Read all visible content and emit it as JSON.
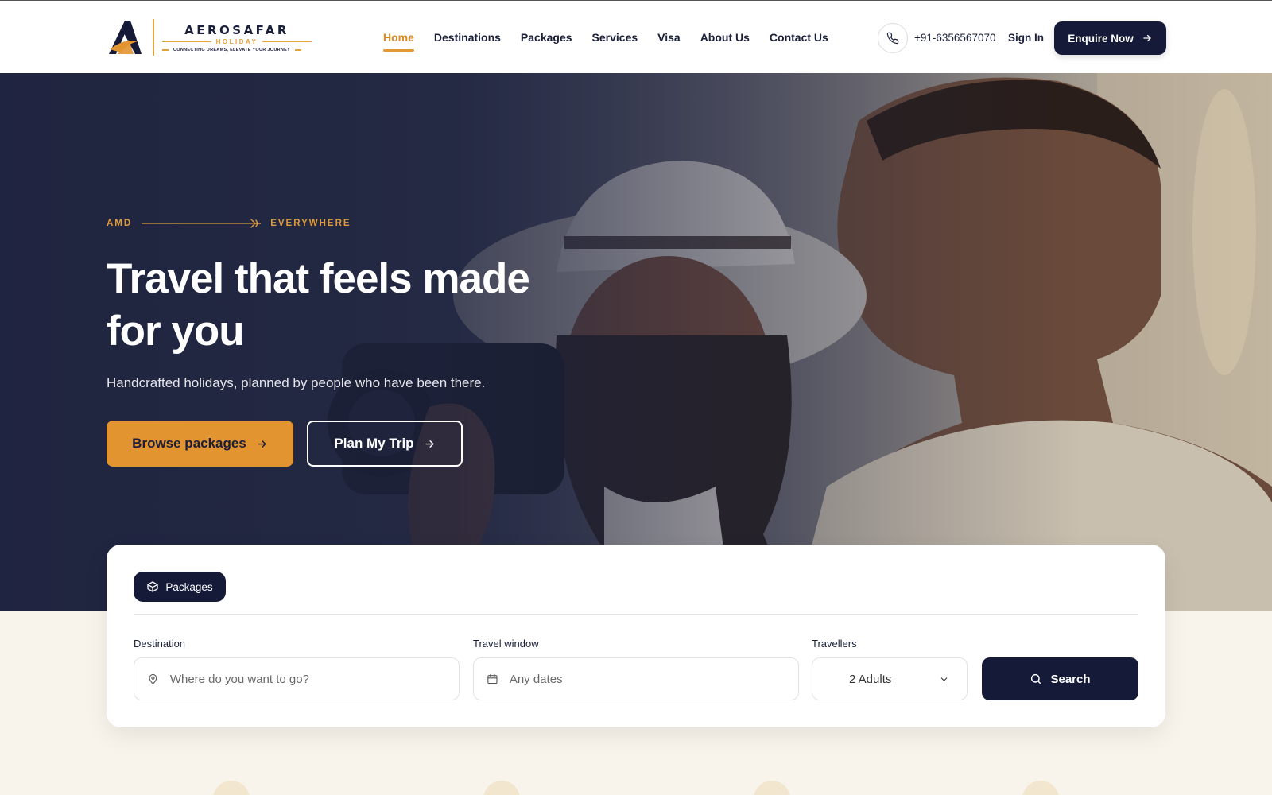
{
  "brand": {
    "name": "AEROSAFAR",
    "sub": "HOLIDAY",
    "tagline": "CONNECTING DREAMS, ELEVATE YOUR JOURNEY"
  },
  "nav": {
    "items": [
      {
        "label": "Home",
        "active": true
      },
      {
        "label": "Destinations",
        "active": false
      },
      {
        "label": "Packages",
        "active": false
      },
      {
        "label": "Services",
        "active": false
      },
      {
        "label": "Visa",
        "active": false
      },
      {
        "label": "About Us",
        "active": false
      },
      {
        "label": "Contact Us",
        "active": false
      }
    ],
    "phone": "+91-6356567070",
    "signin": "Sign In",
    "enquire": "Enquire Now"
  },
  "hero": {
    "eyebrow_from": "AMD",
    "eyebrow_to": "EVERYWHERE",
    "title_line1": "Travel that feels made",
    "title_line2": "for you",
    "subtitle": "Handcrafted holidays, planned by people who have been there.",
    "btn_browse": "Browse packages",
    "btn_plan": "Plan My Trip"
  },
  "search": {
    "tab": "Packages",
    "destination_label": "Destination",
    "destination_placeholder": "Where do you want to go?",
    "window_label": "Travel window",
    "window_placeholder": "Any dates",
    "travellers_label": "Travellers",
    "travellers_value": "2 Adults",
    "search_label": "Search"
  },
  "colors": {
    "navy": "#151a38",
    "accent": "#e29430",
    "cream": "#f8f4ec"
  }
}
